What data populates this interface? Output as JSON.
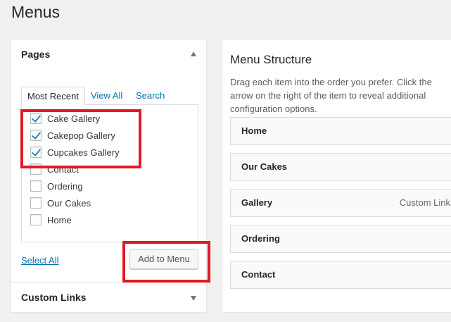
{
  "page": {
    "title": "Menus"
  },
  "pages_box": {
    "title": "Pages",
    "tabs": [
      {
        "label": "Most Recent",
        "active": true
      },
      {
        "label": "View All",
        "active": false
      },
      {
        "label": "Search",
        "active": false
      }
    ],
    "items": [
      {
        "label": "Cake Gallery",
        "checked": true
      },
      {
        "label": "Cakepop Gallery",
        "checked": true
      },
      {
        "label": "Cupcakes Gallery",
        "checked": true
      },
      {
        "label": "Contact",
        "checked": false
      },
      {
        "label": "Ordering",
        "checked": false
      },
      {
        "label": "Our Cakes",
        "checked": false
      },
      {
        "label": "Home",
        "checked": false
      }
    ],
    "select_all": "Select All",
    "add_button": "Add to Menu"
  },
  "custom_links": {
    "title": "Custom Links"
  },
  "menu_structure": {
    "title": "Menu Structure",
    "description": "Drag each item into the order you prefer. Click the arrow on the right of the item to reveal additional configuration options.",
    "items": [
      {
        "label": "Home",
        "type": ""
      },
      {
        "label": "Our Cakes",
        "type": ""
      },
      {
        "label": "Gallery",
        "type": "Custom Link"
      },
      {
        "label": "Ordering",
        "type": ""
      },
      {
        "label": "Contact",
        "type": ""
      }
    ]
  },
  "colors": {
    "link": "#0073aa",
    "highlight": "#e01b24",
    "checkmark": "#1e8cbe"
  }
}
